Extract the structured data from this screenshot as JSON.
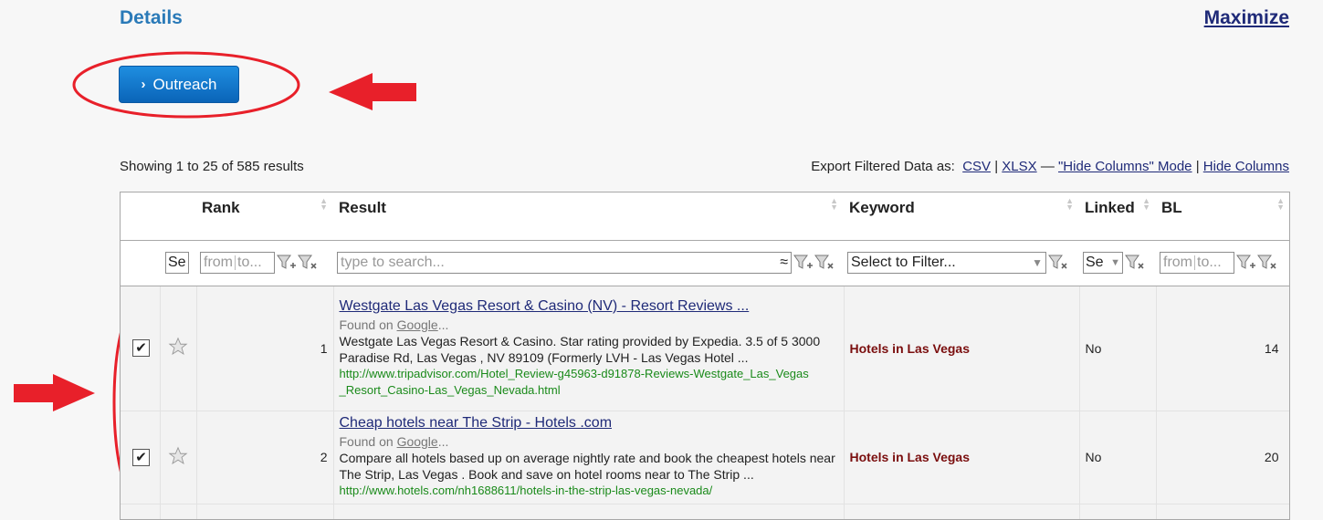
{
  "header": {
    "title": "Details",
    "maximize_label": "Maximize"
  },
  "outreach_button": {
    "label": "Outreach"
  },
  "results_info": {
    "showing": "Showing 1 to 25 of 585 results"
  },
  "export": {
    "label": "Export Filtered Data as:",
    "csv": "CSV",
    "sep1": "|",
    "xlsx": "XLSX",
    "dash": "—",
    "hide_mode": "\"Hide Columns\" Mode",
    "sep2": "|",
    "hide_columns": "Hide Columns"
  },
  "columns": [
    "Rank",
    "Result",
    "Keyword",
    "Linked",
    "BL"
  ],
  "filters": {
    "select_short": "Se",
    "from_placeholder": "from",
    "to_placeholder": "to...",
    "search_placeholder": "type to search...",
    "approx_symbol": "≈",
    "keyword_select": "Select to Filter...",
    "linked_select": "Se"
  },
  "rows": [
    {
      "rank": "1",
      "title": "Westgate Las Vegas Resort & Casino (NV) - Resort Reviews ...",
      "found_prefix": "Found on",
      "found_source": "Google",
      "found_suffix": "...",
      "description": "Westgate Las Vegas Resort & Casino. Star rating provided by Expedia. 3.5 of 5 3000 Paradise Rd, Las Vegas , NV 89109 (Formerly LVH - Las Vegas Hotel  ...",
      "url": "http://www.tripadvisor.com/Hotel_Review-g45963-d91878-Reviews-Westgate_Las_Vegas _Resort_Casino-Las_Vegas_Nevada.html",
      "keyword": "Hotels in Las Vegas",
      "linked": "No",
      "bl": "14",
      "checked": true
    },
    {
      "rank": "2",
      "title": "Cheap hotels near The Strip - Hotels .com",
      "found_prefix": "Found on",
      "found_source": "Google",
      "found_suffix": "...",
      "description": "Compare all hotels based up on average nightly rate and book the cheapest hotels near The Strip, Las Vegas . Book and save on hotel rooms near to The Strip ...",
      "url": "http://www.hotels.com/nh1688611/hotels-in-the-strip-las-vegas-nevada/",
      "keyword": "Hotels in Las Vegas",
      "linked": "No",
      "bl": "20",
      "checked": true
    }
  ],
  "colors": {
    "accent": "#2a7ab8",
    "button": "#0a64b8",
    "link": "#1f2a78",
    "keyword": "#7a0e0e",
    "url": "#1a8a1a",
    "annotation": "#e8202a"
  },
  "icons": [
    "chevron-right-icon",
    "sort-arrows-icon",
    "filter-add-icon",
    "filter-clear-icon",
    "star-icon",
    "check-icon",
    "dropdown-arrow-icon"
  ]
}
